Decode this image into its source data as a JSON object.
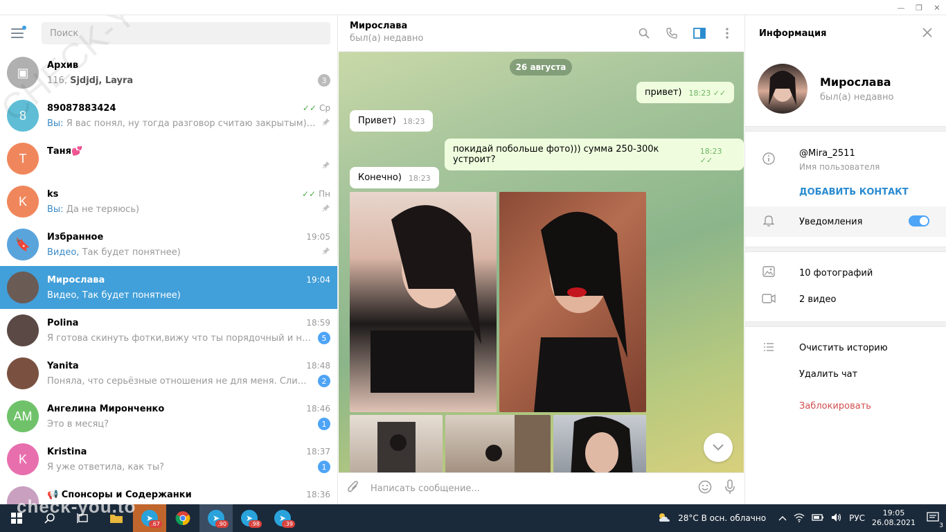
{
  "window": {
    "minimize": "—",
    "maximize": "❐",
    "close": "✕"
  },
  "sidebar": {
    "search_placeholder": "Поиск",
    "chats": [
      {
        "name": "Архив",
        "preview_prefix": "116, ",
        "preview_bold": "Sjdjdj, Layra",
        "time": "",
        "badge": "3",
        "badge_grey": true,
        "avatar_color": "#b0b0b0",
        "avatar_text": "▣"
      },
      {
        "name": "89087883424",
        "preview_prefix": "Вы:",
        "preview": " Я вас понял, ну тогда разговор считаю закрытым) всего ...",
        "time": "Ср",
        "ticks": "✓✓",
        "pinned": true,
        "avatar_color": "#5fbed5",
        "avatar_text": "8"
      },
      {
        "name": "Таня💕",
        "preview": "",
        "time": "",
        "pinned": true,
        "avatar_color": "#f0875c",
        "avatar_text": "Т"
      },
      {
        "name": "ks",
        "preview_prefix": "Вы:",
        "preview": " Да не теряюсь)",
        "time": "Пн",
        "ticks": "✓✓",
        "pinned": true,
        "avatar_color": "#f0875c",
        "avatar_text": "K"
      },
      {
        "name": "Избранное",
        "preview_prefix": "Видео,",
        "preview": " Так будет понятнее)",
        "time": "19:05",
        "pinned": true,
        "avatar_color": "#5aa4dc",
        "avatar_text": "🔖"
      },
      {
        "name": "Мирослава",
        "preview": "Видео, Так будет понятнее)",
        "time": "19:04",
        "active": true,
        "avatar_color": "#6b5b55",
        "avatar_text": ""
      },
      {
        "name": "Polina",
        "preview": "Я готова скинуть фотки,вижу что ты порядочный и не кине...",
        "time": "18:59",
        "badge": "5",
        "avatar_color": "#5a4944",
        "avatar_text": ""
      },
      {
        "name": "Yanita",
        "preview": "Поняла, что серьёзные отношения не для меня. Слишком л...",
        "time": "18:48",
        "badge": "2",
        "avatar_color": "#7a5140",
        "avatar_text": ""
      },
      {
        "name": "Ангелина Миронченко",
        "preview": "Это в месяц?",
        "time": "18:46",
        "badge": "1",
        "avatar_color": "#70c26a",
        "avatar_text": "AM"
      },
      {
        "name": "Kristina",
        "preview": "Я уже ответила, как ты?",
        "time": "18:37",
        "badge": "1",
        "avatar_color": "#e86fae",
        "avatar_text": "K"
      },
      {
        "name": "📢 Спонсоры и Содержанки",
        "preview": "",
        "time": "18:36",
        "avatar_color": "#c9a0c0",
        "avatar_text": ""
      }
    ]
  },
  "chat": {
    "title": "Мирослава",
    "status": "был(а) недавно",
    "date_pill": "26 августа",
    "messages": [
      {
        "text": "привет)",
        "time": "18:23",
        "out": true,
        "ticks": "✓✓"
      },
      {
        "text": "Привет)",
        "time": "18:23",
        "out": false
      },
      {
        "text": "покидай побольше фото))) сумма 250-300к устроит?",
        "time": "18:23",
        "out": true,
        "ticks": "✓✓"
      },
      {
        "text": "Конечно)",
        "time": "18:23",
        "out": false
      }
    ],
    "composer_placeholder": "Написать сообщение..."
  },
  "info": {
    "title": "Информация",
    "name": "Мирослава",
    "status": "был(а) недавно",
    "username": "@Mira_2511",
    "username_label": "Имя пользователя",
    "add_contact": "ДОБАВИТЬ КОНТАКТ",
    "notifications": "Уведомления",
    "notifications_on": true,
    "photos": "10 фотографий",
    "videos": "2 видео",
    "clear_history": "Очистить историю",
    "delete_chat": "Удалить чат",
    "block": "Заблокировать"
  },
  "taskbar": {
    "weather": "28°C  В осн. облачно",
    "lang": "РУС",
    "time": "19:05",
    "date": "26.08.2021",
    "notif_count": "3",
    "badges": [
      ".67",
      ".90",
      ".98",
      ".39"
    ]
  },
  "watermark": {
    "main": "check-you.to",
    "diag": "CHECK-YOU.ME"
  }
}
